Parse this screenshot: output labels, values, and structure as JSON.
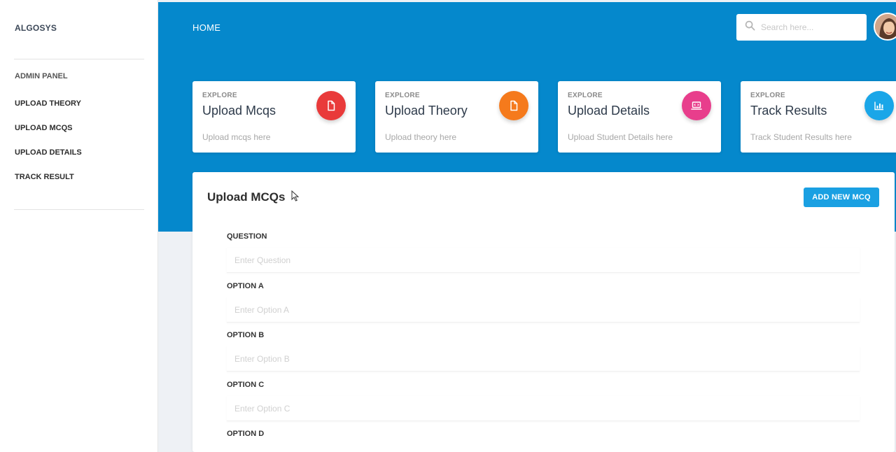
{
  "sidebar": {
    "brand": "ALGOSYS",
    "section_label": "ADMIN PANEL",
    "items": [
      {
        "label": "UPLOAD THEORY"
      },
      {
        "label": "UPLOAD MCQS"
      },
      {
        "label": "UPLOAD DETAILS"
      },
      {
        "label": "TRACK RESULT"
      }
    ]
  },
  "header": {
    "home_label": "HOME",
    "search_placeholder": "Search here..."
  },
  "cards": [
    {
      "eyebrow": "EXPLORE",
      "title": "Upload Mcqs",
      "desc": "Upload mcqs here",
      "icon": "document-icon",
      "color": "#e93a3a"
    },
    {
      "eyebrow": "EXPLORE",
      "title": "Upload Theory",
      "desc": "Upload theory here",
      "icon": "document-icon",
      "color": "#f57a1c"
    },
    {
      "eyebrow": "EXPLORE",
      "title": "Upload Details",
      "desc": "Upload Student Details here",
      "icon": "laptop-icon",
      "color": "#e83e8c"
    },
    {
      "eyebrow": "EXPLORE",
      "title": "Track Results",
      "desc": "Track Student Results here",
      "icon": "bar-chart-icon",
      "color": "#1aa6e8"
    }
  ],
  "form": {
    "title": "Upload MCQs",
    "add_button": "ADD NEW MCQ",
    "fields": [
      {
        "label": "QUESTION",
        "placeholder": "Enter Question",
        "value": ""
      },
      {
        "label": "OPTION A",
        "placeholder": "Enter Option A",
        "value": ""
      },
      {
        "label": "OPTION B",
        "placeholder": "Enter Option B",
        "value": ""
      },
      {
        "label": "OPTION C",
        "placeholder": "Enter Option C",
        "value": ""
      },
      {
        "label": "OPTION D",
        "placeholder": "",
        "value": ""
      }
    ]
  },
  "colors": {
    "header_blue": "#0588cc",
    "accent_button": "#1aa0e2"
  }
}
